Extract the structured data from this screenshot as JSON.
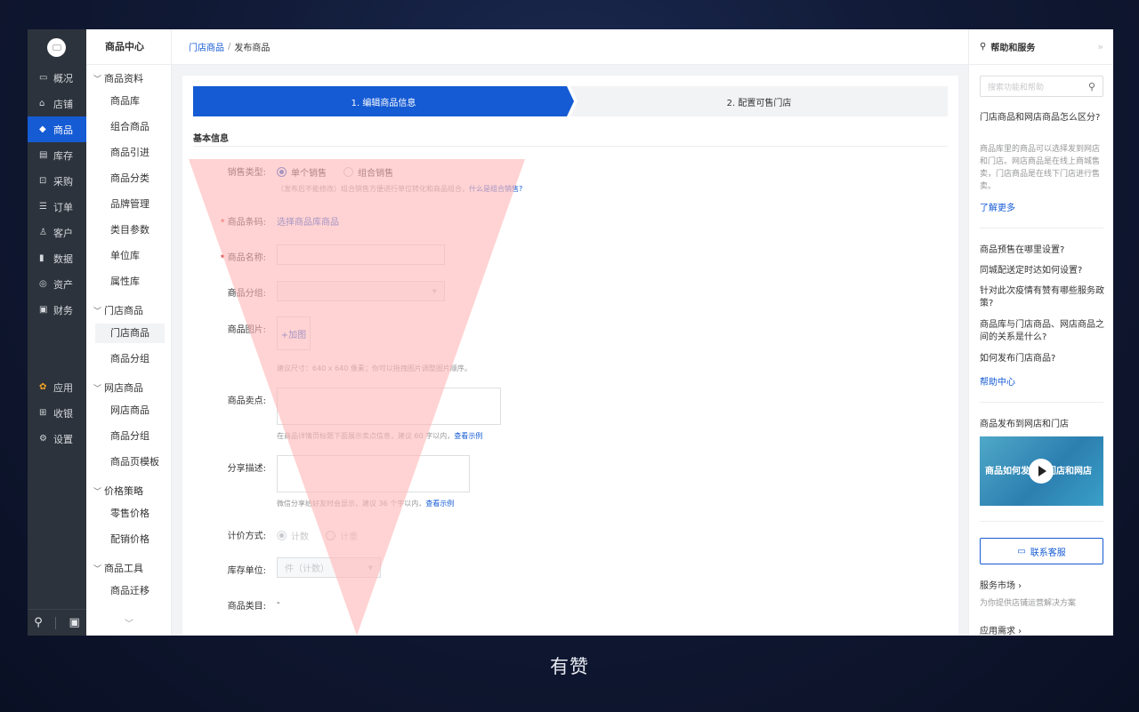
{
  "app": {
    "caption": "有赞"
  },
  "primary_nav": {
    "items": [
      {
        "label": "概况",
        "icon": "monitor-icon",
        "active": false
      },
      {
        "label": "店铺",
        "icon": "store-icon",
        "active": false
      },
      {
        "label": "商品",
        "icon": "tag-icon",
        "active": true
      },
      {
        "label": "库存",
        "icon": "warehouse-icon",
        "active": false
      },
      {
        "label": "采购",
        "icon": "purchase-icon",
        "active": false
      },
      {
        "label": "订单",
        "icon": "order-icon",
        "active": false
      },
      {
        "label": "客户",
        "icon": "user-icon",
        "active": false
      },
      {
        "label": "数据",
        "icon": "bar-chart-icon",
        "active": false
      },
      {
        "label": "资产",
        "icon": "coin-icon",
        "active": false
      },
      {
        "label": "财务",
        "icon": "wallet-icon",
        "active": false
      }
    ],
    "bottom_items": [
      {
        "label": "应用",
        "icon": "apps-icon"
      },
      {
        "label": "收银",
        "icon": "cashier-icon"
      },
      {
        "label": "设置",
        "icon": "gear-icon"
      }
    ]
  },
  "secondary_nav": {
    "title": "商品中心",
    "groups": [
      {
        "label": "商品资料",
        "items": [
          "商品库",
          "组合商品",
          "商品引进",
          "商品分类",
          "品牌管理",
          "类目参数",
          "单位库",
          "属性库"
        ]
      },
      {
        "label": "门店商品",
        "items": [
          "门店商品",
          "商品分组"
        ]
      },
      {
        "label": "网店商品",
        "items": [
          "网店商品",
          "商品分组",
          "商品页模板"
        ]
      },
      {
        "label": "价格策略",
        "items": [
          "零售价格",
          "配销价格"
        ]
      },
      {
        "label": "商品工具",
        "items": [
          "商品迁移"
        ]
      }
    ],
    "active_item": "门店商品"
  },
  "breadcrumb": {
    "parent": "门店商品",
    "separator": "/",
    "current": "发布商品"
  },
  "steps": {
    "step1": "1. 编辑商品信息",
    "step2": "2. 配置可售门店"
  },
  "form": {
    "section_title": "基本信息",
    "sale_type": {
      "label": "销售类型:",
      "options": [
        "单个销售",
        "组合销售"
      ],
      "selected": "单个销售",
      "help": "（发布后不能修改）组合销售方便进行单位转化和商品组合，",
      "help_link": "什么是组合销售?"
    },
    "barcode": {
      "label": "商品条码:",
      "link": "选择商品库商品"
    },
    "name": {
      "label": "商品名称:",
      "value": ""
    },
    "group": {
      "label": "商品分组:",
      "value": ""
    },
    "images": {
      "label": "商品图片:",
      "add_label": "+加图",
      "help": "建议尺寸：640 x 640 像素；你可以拖拽图片调整图片顺序。"
    },
    "selling_points": {
      "label": "商品卖点:",
      "help": "在商品详情页标题下面展示卖点信息，建议 60 字以内，",
      "help_link": "查看示例"
    },
    "share_desc": {
      "label": "分享描述:",
      "help": "微信分享给好友时会显示，建议 36 个字以内，",
      "help_link": "查看示例"
    },
    "pricing": {
      "label": "计价方式:",
      "options": [
        "计数",
        "计重"
      ],
      "selected": "计数"
    },
    "stock_unit": {
      "label": "库存单位:",
      "value": "件（计数）"
    },
    "category": {
      "label": "商品类目:",
      "value": "-"
    }
  },
  "help_panel": {
    "title": "帮助和服务",
    "search_placeholder": "搜索功能和帮助",
    "faq_title": "门店商品和网店商品怎么区分?",
    "faq_body": "商品库里的商品可以选择发到网店和门店。网店商品是在线上商城售卖，门店商品是在线下门店进行售卖。",
    "learn_more": "了解更多",
    "questions": [
      "商品预售在哪里设置?",
      "同城配送定时达如何设置?",
      "针对此次疫情有赞有哪些服务政策?",
      "商品库与门店商品、网店商品之间的关系是什么?",
      "如何发布门店商品?"
    ],
    "help_center": "帮助中心",
    "video_title": "商品发布到网店和门店",
    "video_overlay": "商品如何发布到门店和网店",
    "contact": "联系客服",
    "market_title": "服务市场 ›",
    "market_desc": "为你提供店铺运营解决方案",
    "app_demand": "应用需求 ›"
  },
  "colors": {
    "brand_blue": "#155bd4",
    "sidebar_dark": "#2d333c",
    "overlay_red": "#ffb8b8"
  }
}
